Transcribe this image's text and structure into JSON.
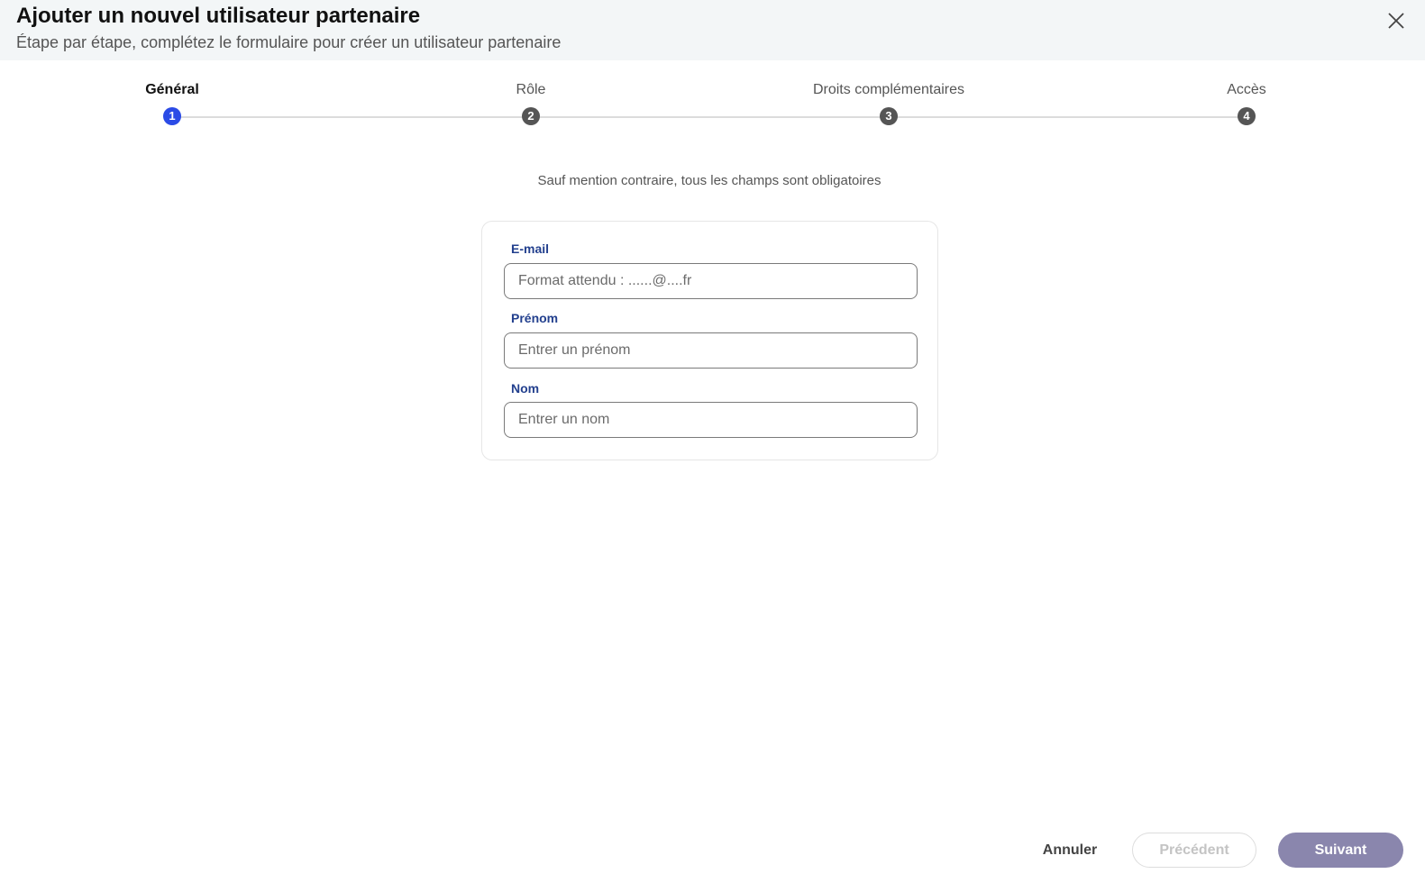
{
  "header": {
    "title": "Ajouter un nouvel utilisateur partenaire",
    "subtitle": "Étape par étape, complétez le formulaire pour créer un utilisateur partenaire",
    "close_icon": "close-icon"
  },
  "stepper": {
    "current_step": 1,
    "steps": [
      {
        "label": "Général",
        "number": "1"
      },
      {
        "label": "Rôle",
        "number": "2"
      },
      {
        "label": "Droits complémentaires",
        "number": "3"
      },
      {
        "label": "Accès",
        "number": "4"
      }
    ],
    "active_color": "#2b4be6",
    "inactive_color": "#555555"
  },
  "form": {
    "notice": "Sauf mention contraire, tous les champs sont obligatoires",
    "fields": [
      {
        "label": "E-mail",
        "placeholder": "Format attendu : ......@....fr",
        "value": ""
      },
      {
        "label": "Prénom",
        "placeholder": "Entrer un prénom",
        "value": ""
      },
      {
        "label": "Nom",
        "placeholder": "Entrer un nom",
        "value": ""
      }
    ],
    "label_color": "#23408e"
  },
  "footer": {
    "cancel_label": "Annuler",
    "previous_label": "Précédent",
    "next_label": "Suivant",
    "next_color": "#8a86ad"
  }
}
